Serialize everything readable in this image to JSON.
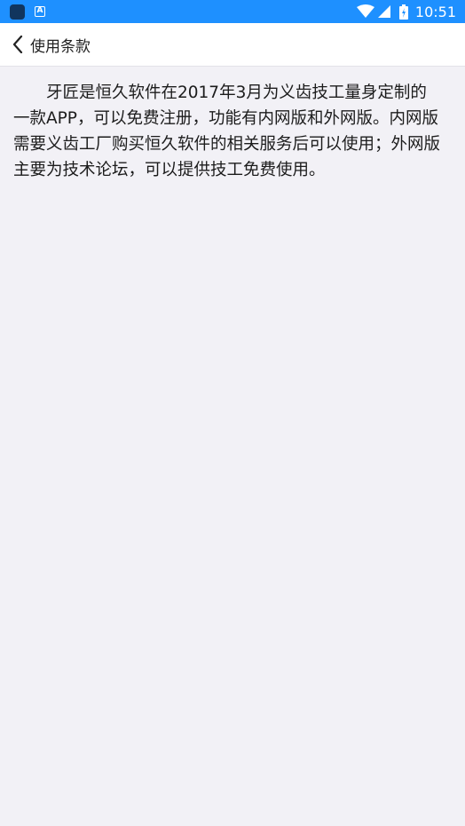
{
  "status_bar": {
    "time": "10:51",
    "icons": [
      "app-notification-icon",
      "a-notification-icon",
      "wifi-icon",
      "cell-signal-icon",
      "battery-icon"
    ],
    "background": "#1e90ff"
  },
  "header": {
    "back_icon": "chevron-left-icon",
    "title": "使用条款"
  },
  "main": {
    "terms_text": "牙匠是恒久软件在2017年3月为义齿技工量身定制的一款APP，可以免费注册，功能有内网版和外网版。内网版需要义齿工厂购买恒久软件的相关服务后可以使用；外网版主要为技术论坛，可以提供技工免费使用。"
  },
  "colors": {
    "page_background": "#f2f1f6",
    "navbar_background": "#ffffff",
    "text": "#1c1c1c"
  }
}
